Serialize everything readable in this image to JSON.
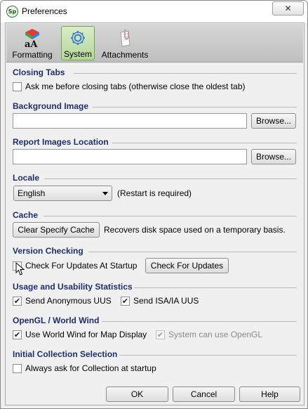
{
  "window": {
    "title": "Preferences",
    "app_icon_text": "Sp",
    "close_glyph": "✕"
  },
  "toolbar": {
    "items": [
      {
        "label": "Formatting",
        "icon": "formatting-icon",
        "selected": false
      },
      {
        "label": "System",
        "icon": "gear-icon",
        "selected": true
      },
      {
        "label": "Attachments",
        "icon": "attachments-icon",
        "selected": false
      }
    ]
  },
  "sections": {
    "closing_tabs": {
      "header": "Closing Tabs",
      "checkbox_label": "Ask me before closing tabs (otherwise close the oldest tab)",
      "checked": false
    },
    "background_image": {
      "header": "Background Image",
      "value": "",
      "browse_label": "Browse..."
    },
    "report_images": {
      "header": "Report Images Location",
      "value": "",
      "browse_label": "Browse..."
    },
    "locale": {
      "header": "Locale",
      "selected": "English",
      "note": "(Restart is required)"
    },
    "cache": {
      "header": "Cache",
      "button_label": "Clear Specify Cache",
      "description": "Recovers disk space used on a temporary basis."
    },
    "version_checking": {
      "header": "Version Checking",
      "checkbox_label": "Check For Updates At Startup",
      "checked": false,
      "button_label": "Check For Updates"
    },
    "usage": {
      "header": "Usage and Usability Statistics",
      "anon_label": "Send Anonymous UUS",
      "anon_checked": true,
      "isa_label": "Send ISA/IA UUS",
      "isa_checked": true
    },
    "opengl": {
      "header": "OpenGL / World Wind",
      "worldwind_label": "Use World Wind for Map Display",
      "worldwind_checked": true,
      "opengl_label": "System can use OpenGL",
      "opengl_checked": true
    },
    "initial_collection": {
      "header": "Initial Collection Selection",
      "checkbox_label": "Always ask for Collection at startup",
      "checked": false
    }
  },
  "footer": {
    "ok_label": "OK",
    "cancel_label": "Cancel",
    "help_label": "Help"
  },
  "check_glyph": "✔"
}
